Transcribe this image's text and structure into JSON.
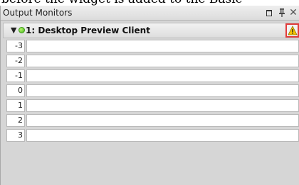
{
  "caption": {
    "text": "before the widget is added to the Basic"
  },
  "panel": {
    "title": "Output Monitors",
    "buttons": {
      "pin_glyph": "⬪",
      "close_glyph": "✕"
    }
  },
  "client": {
    "arrow_glyph": "▼",
    "name": "1: Desktop Preview Client",
    "status_color": "#47b61d",
    "warning_icon": "warning-icon",
    "warning_highlight_color": "#e23b3b"
  },
  "monitor_rows": [
    {
      "index": "-3"
    },
    {
      "index": "-2"
    },
    {
      "index": "-1"
    },
    {
      "index": "0"
    },
    {
      "index": "1"
    },
    {
      "index": "2"
    },
    {
      "index": "3"
    }
  ]
}
